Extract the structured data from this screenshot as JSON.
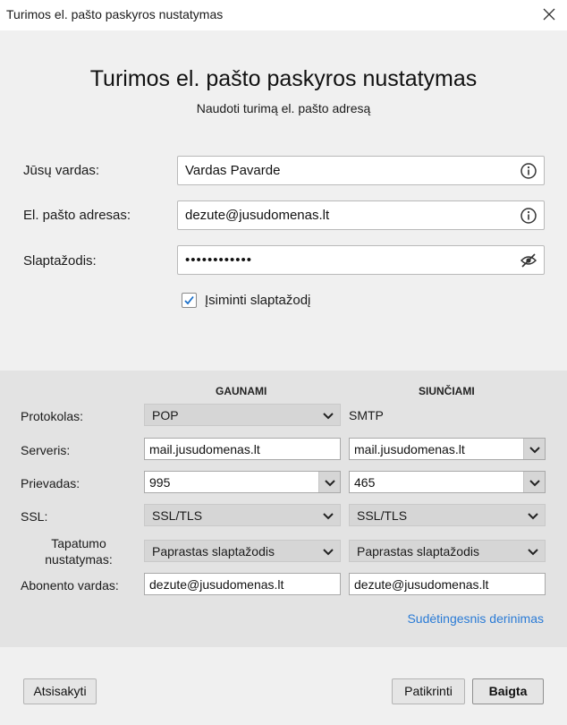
{
  "window": {
    "title": "Turimos el. pašto paskyros nustatymas"
  },
  "header": {
    "title": "Turimos el. pašto paskyros nustatymas",
    "subtitle": "Naudoti turimą el. pašto adresą"
  },
  "account": {
    "name_label": "Jūsų vardas:",
    "name_value": "Vardas Pavarde",
    "email_label": "El. pašto adresas:",
    "email_value": "dezute@jusudomenas.lt",
    "password_label": "Slaptažodis:",
    "password_value": "••••••••••••",
    "remember_label": "Įsiminti slaptažodį",
    "remember_checked": true
  },
  "server": {
    "incoming_header": "GAUNAMI",
    "outgoing_header": "SIUNČIAMI",
    "protocol_label": "Protokolas:",
    "incoming_protocol": "POP",
    "outgoing_protocol": "SMTP",
    "server_label": "Serveris:",
    "incoming_server": "mail.jusudomenas.lt",
    "outgoing_server": "mail.jusudomenas.lt",
    "port_label": "Prievadas:",
    "incoming_port": "995",
    "outgoing_port": "465",
    "ssl_label": "SSL:",
    "incoming_ssl": "SSL/TLS",
    "outgoing_ssl": "SSL/TLS",
    "auth_label_line1": "Tapatumo",
    "auth_label_line2": "nustatymas:",
    "incoming_auth": "Paprastas slaptažodis",
    "outgoing_auth": "Paprastas slaptažodis",
    "username_label": "Abonento vardas:",
    "incoming_username": "dezute@jusudomenas.lt",
    "outgoing_username": "dezute@jusudomenas.lt",
    "advanced_link": "Sudėtingesnis derinimas"
  },
  "footer": {
    "cancel": "Atsisakyti",
    "test": "Patikrinti",
    "done": "Baigta"
  },
  "colors": {
    "accent_link": "#2a7bd6",
    "checkbox_tick": "#1a6fc9",
    "upper_bg": "#f0f0f0",
    "lower_bg": "#e3e3e3"
  }
}
